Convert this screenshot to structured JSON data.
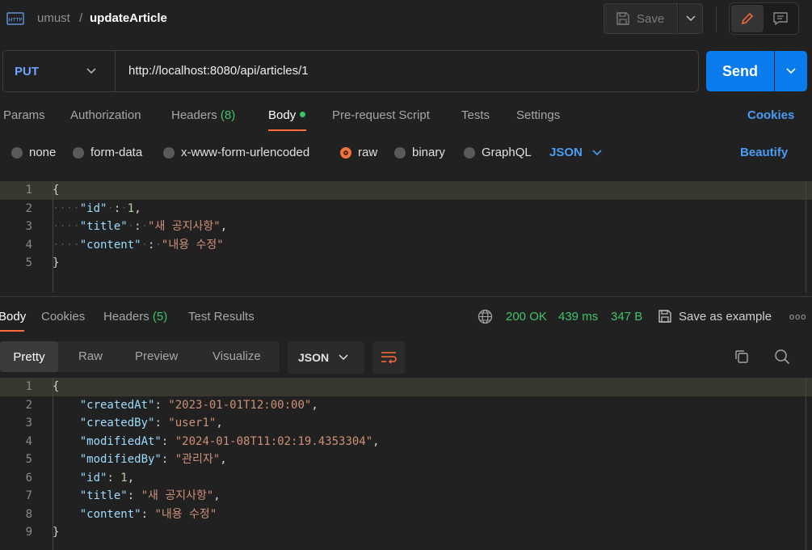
{
  "header": {
    "icon": "http-request-icon",
    "collection": "umust",
    "separator": "/",
    "request_name": "updateArticle",
    "save_label": "Save"
  },
  "request": {
    "method": "PUT",
    "url": "http://localhost:8080/api/articles/1",
    "send_label": "Send"
  },
  "tabs": {
    "params": "Params",
    "authorization": "Authorization",
    "headers": "Headers",
    "headers_count": "(8)",
    "body": "Body",
    "prerequest": "Pre-request Script",
    "tests": "Tests",
    "settings": "Settings",
    "cookies": "Cookies"
  },
  "body_types": {
    "none": "none",
    "form_data": "form-data",
    "urlencoded": "x-www-form-urlencoded",
    "raw": "raw",
    "binary": "binary",
    "graphql": "GraphQL",
    "selected": "raw",
    "format": "JSON",
    "beautify": "Beautify"
  },
  "request_body": [
    {
      "num": "1",
      "text": "{"
    },
    {
      "num": "2",
      "key": "\"id\"",
      "value": "1",
      "value_type": "number"
    },
    {
      "num": "3",
      "key": "\"title\"",
      "value": "\"새 공지사항\"",
      "value_type": "string"
    },
    {
      "num": "4",
      "key": "\"content\"",
      "value": "\"내용 수정\"",
      "value_type": "string"
    },
    {
      "num": "5",
      "text": "}"
    }
  ],
  "response": {
    "tabs": {
      "body": "Body",
      "cookies": "Cookies",
      "headers": "Headers",
      "headers_count": "(5)",
      "test_results": "Test Results"
    },
    "status": "200 OK",
    "time": "439 ms",
    "size": "347 B",
    "save_example": "Save as example",
    "more": "ooo",
    "modes": {
      "pretty": "Pretty",
      "raw": "Raw",
      "preview": "Preview",
      "visualize": "Visualize"
    },
    "format": "JSON",
    "body": [
      {
        "num": "1",
        "text": "{"
      },
      {
        "num": "2",
        "key": "\"createdAt\"",
        "value": "\"2023-01-01T12:00:00\"",
        "comma": true
      },
      {
        "num": "3",
        "key": "\"createdBy\"",
        "value": "\"user1\"",
        "comma": true
      },
      {
        "num": "4",
        "key": "\"modifiedAt\"",
        "value": "\"2024-01-08T11:02:19.4353304\"",
        "comma": true
      },
      {
        "num": "5",
        "key": "\"modifiedBy\"",
        "value": "\"관리자\"",
        "comma": true
      },
      {
        "num": "6",
        "key": "\"id\"",
        "value": "1",
        "comma": true,
        "number": true
      },
      {
        "num": "7",
        "key": "\"title\"",
        "value": "\"새 공지사항\"",
        "comma": true
      },
      {
        "num": "8",
        "key": "\"content\"",
        "value": "\"내용 수정\"",
        "comma": false
      },
      {
        "num": "9",
        "text": "}"
      }
    ]
  },
  "colors": {
    "accent": "#ff6c37",
    "send": "#097bed",
    "link": "#4a9cf5",
    "success": "#3fc36b"
  }
}
